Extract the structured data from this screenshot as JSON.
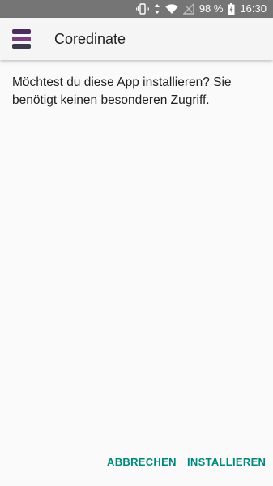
{
  "status_bar": {
    "battery_percent": "98 %",
    "time": "16:30",
    "icons": [
      "vibrate-icon",
      "data-arrows-icon",
      "wifi-icon",
      "no-signal-icon",
      "battery-icon"
    ]
  },
  "app_bar": {
    "title": "Coredinate",
    "icon": "coredinate-logo-icon"
  },
  "dialog": {
    "message": "Möchtest du diese App installieren? Sie benötigt keinen besonderen Zugriff."
  },
  "buttons": {
    "cancel_label": "ABBRECHEN",
    "install_label": "INSTALLIEREN"
  },
  "colors": {
    "status_bar": "#757575",
    "app_bar": "#f5f5f5",
    "background": "#fafafa",
    "accent": "#00897b",
    "logo_top": "#4a2c5e",
    "logo_middle": "#7a3d80",
    "logo_bottom": "#3a3a4a"
  }
}
